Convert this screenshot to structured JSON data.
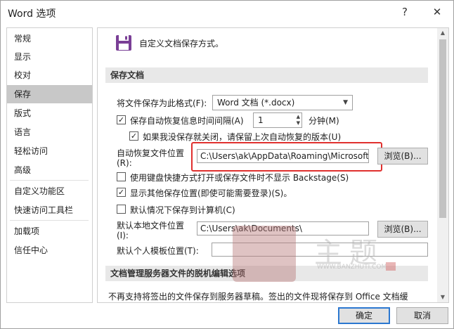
{
  "window": {
    "title": "Word 选项",
    "help_label": "?",
    "close_label": "✕"
  },
  "sidebar": {
    "items": [
      {
        "label": "常规"
      },
      {
        "label": "显示"
      },
      {
        "label": "校对"
      },
      {
        "label": "保存"
      },
      {
        "label": "版式"
      },
      {
        "label": "语言"
      },
      {
        "label": "轻松访问"
      },
      {
        "label": "高级"
      },
      {
        "label": "自定义功能区"
      },
      {
        "label": "快速访问工具栏"
      },
      {
        "label": "加载项"
      },
      {
        "label": "信任中心"
      }
    ],
    "active_index": 3
  },
  "main": {
    "header_icon": "save-icon",
    "header_text": "自定义文档保存方式。",
    "section1_title": "保存文档",
    "format_label": "将文件保存为此格式(F):",
    "format_value": "Word 文档 (*.docx)",
    "autorecover_label": "保存自动恢复信息时间间隔(A)",
    "autorecover_minutes": "1",
    "minutes_label": "分钟(M)",
    "keep_last_label": "如果我没保存就关闭，请保留上次自动恢复的版本(U)",
    "autorecover_loc_label_1": "自动恢复文件位置",
    "autorecover_loc_label_2": "(R):",
    "autorecover_path": "C:\\Users\\ak\\AppData\\Roaming\\Microsoft",
    "browse1_label": "浏览(B)...",
    "no_backstage_label": "使用键盘快捷方式打开或保存文件时不显示 Backstage(S)",
    "show_other_label": "显示其他保存位置(即使可能需要登录)(S)。",
    "save_to_computer_label": "默认情况下保存到计算机(C)",
    "default_local_label_1": "默认本地文件位置",
    "default_local_label_2": "(I):",
    "default_local_path": "C:\\Users\\ak\\Documents\\",
    "browse2_label": "浏览(B)...",
    "template_label": "默认个人模板位置(T):",
    "template_path": "",
    "section2_title": "文档管理服务器文件的脱机编辑选项",
    "server_text": "不再支持将签出的文件保存到服务器草稿。签出的文件现将保存到 Office 文档缓"
  },
  "checkboxes": {
    "autorecover": "✓",
    "keep_last": "✓",
    "no_backstage": "",
    "show_other": "✓",
    "save_to_computer": ""
  },
  "footer": {
    "ok_label": "确定",
    "cancel_label": "取消"
  },
  "watermark": {
    "text": "主题",
    "url": "WWW.BANZHUTI.COM"
  },
  "colors": {
    "highlight_border": "#e0302e",
    "primary_border": "#2b78d0",
    "active_nav": "#c8c8c8"
  }
}
